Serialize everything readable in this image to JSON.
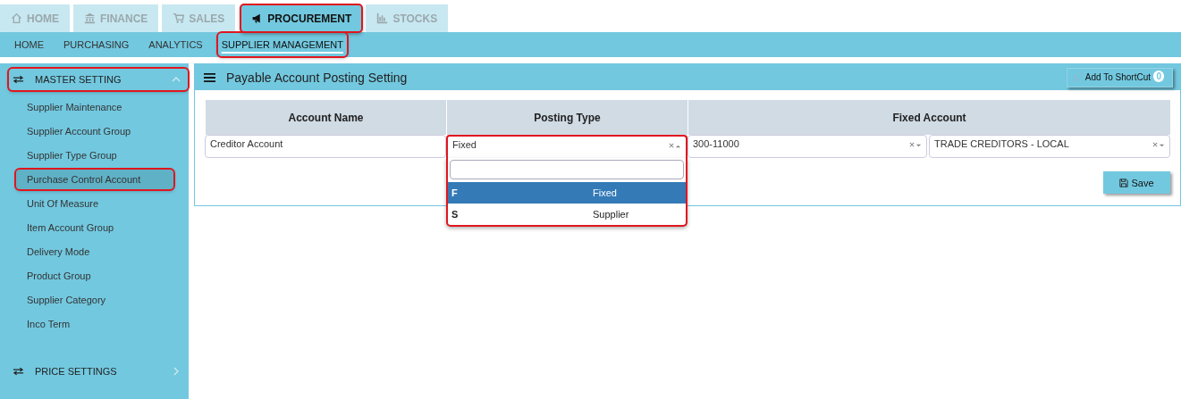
{
  "top_tabs": [
    {
      "label": "HOME",
      "selected": false,
      "highlighted": false
    },
    {
      "label": "FINANCE",
      "selected": false,
      "highlighted": false
    },
    {
      "label": "SALES",
      "selected": false,
      "highlighted": false
    },
    {
      "label": "PROCUREMENT",
      "selected": true,
      "highlighted": true
    },
    {
      "label": "STOCKS",
      "selected": false,
      "highlighted": false
    }
  ],
  "sub_tabs": [
    {
      "label": "HOME",
      "selected": false,
      "highlighted": false
    },
    {
      "label": "PURCHASING",
      "selected": false,
      "highlighted": false
    },
    {
      "label": "ANALYTICS",
      "selected": false,
      "highlighted": false
    },
    {
      "label": "SUPPLIER MANAGEMENT",
      "selected": true,
      "highlighted": true
    }
  ],
  "sidebar": {
    "sections": [
      {
        "label": "MASTER SETTING",
        "expanded": true,
        "highlighted": true,
        "items": [
          {
            "label": "Supplier Maintenance",
            "selected": false,
            "highlighted": false
          },
          {
            "label": "Supplier Account Group",
            "selected": false,
            "highlighted": false
          },
          {
            "label": "Supplier Type Group",
            "selected": false,
            "highlighted": false
          },
          {
            "label": "Purchase Control Account",
            "selected": true,
            "highlighted": true
          },
          {
            "label": "Unit Of Measure",
            "selected": false,
            "highlighted": false
          },
          {
            "label": "Item Account Group",
            "selected": false,
            "highlighted": false
          },
          {
            "label": "Delivery Mode",
            "selected": false,
            "highlighted": false
          },
          {
            "label": "Product Group",
            "selected": false,
            "highlighted": false
          },
          {
            "label": "Supplier Category",
            "selected": false,
            "highlighted": false
          },
          {
            "label": "Inco Term",
            "selected": false,
            "highlighted": false
          }
        ]
      },
      {
        "label": "PRICE SETTINGS",
        "expanded": false,
        "highlighted": false
      }
    ]
  },
  "panel": {
    "title": "Payable Account Posting Setting",
    "shortcut_button": "Add To ShortCut",
    "shortcut_count": "0",
    "table": {
      "columns": [
        "Account Name",
        "Posting Type",
        "Fixed Account"
      ],
      "row": {
        "account_name": "Creditor Account",
        "posting_type": "Fixed",
        "fixed_account_code": "300-11000",
        "fixed_account_name": "TRADE CREDITORS - LOCAL"
      }
    },
    "dropdown": {
      "open": true,
      "highlighted": true,
      "options": [
        {
          "code": "F",
          "label": "Fixed",
          "selected": true
        },
        {
          "code": "S",
          "label": "Supplier",
          "selected": false
        }
      ]
    },
    "save_button": "Save"
  }
}
